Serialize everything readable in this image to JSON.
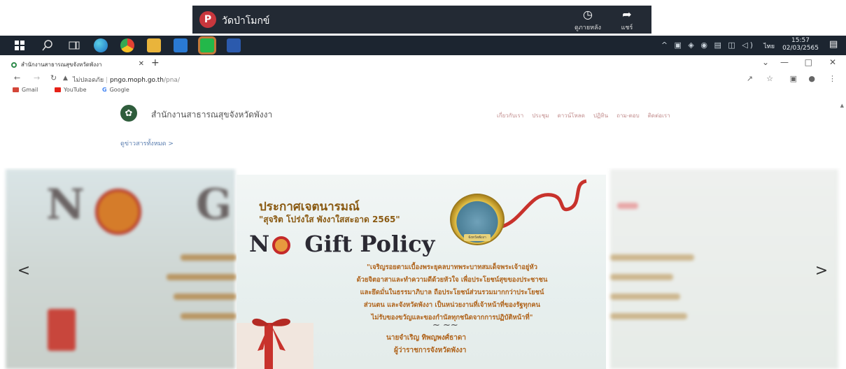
{
  "notification": {
    "avatar_letter": "P",
    "title": "วัดป่าโมกข์",
    "actions": [
      {
        "icon": "clock-icon",
        "label": "ดูภายหลัง"
      },
      {
        "icon": "share-icon",
        "label": "แชร์"
      }
    ]
  },
  "taskbar": {
    "apps": [
      "windows-start-icon",
      "search-icon",
      "task-view-icon",
      "edge-icon",
      "chrome-icon",
      "file-explorer-icon",
      "mail-icon",
      "line-icon",
      "word-icon"
    ],
    "language": "ไทย",
    "time": "15:57",
    "date": "02/03/2565"
  },
  "browser": {
    "tab_title": "สำนักงานสาธารณสุขจังหวัดพังงา",
    "security_label": "ไม่ปลอดภัย",
    "url_host": "pngo.moph.go.th",
    "url_path": "/pna/",
    "bookmarks": [
      "Gmail",
      "YouTube",
      "Google"
    ]
  },
  "site": {
    "name": "สำนักงานสาธารณสุขจังหวัดพังงา",
    "menu": [
      "เกี่ยวกับเรา",
      "ประชุม",
      "ดาวน์โหลด",
      "ปฏิทิน",
      "ถาม-ตอบ",
      "ติดต่อเรา"
    ],
    "news_link": "ดูข่าวสารทั้งหมด >"
  },
  "slide": {
    "heading": "ประกาศเจตนารมณ์",
    "subheading": "\"สุจริต โปร่งใส พังงาใสสะอาด 2565\"",
    "no_letter": "N",
    "policy": "Gift Policy",
    "quote_lines": [
      "\"เจริญรอยตามเบื้องพระยุคลบาทพระบาทสมเด็จพระเจ้าอยู่หัว",
      "ด้วยจิตอาสาและทำความดีด้วยหัวใจ เพื่อประโยชน์สุขของประชาชน",
      "และยึดมั่นในธรรมาภิบาล ถือประโยชน์ส่วนรวมมากกว่าประโยชน์",
      "ส่วนตน และจังหวัดพังงา เป็นหน่วยงานที่เจ้าหน้าที่ของรัฐทุกคน",
      "ไม่รับของขวัญและของกำนัลทุกชนิดจากการปฏิบัติหน้าที่\""
    ],
    "signer_name": "นายจำเริญ ทิพญพงศ์ธาดา",
    "signer_title": "ผู้ว่าราชการจังหวัดพังงา",
    "seal_text": "จังหวัดพังงา"
  },
  "blurred_slide": {
    "big_letters": [
      "N",
      "G"
    ]
  },
  "carousel": {
    "prev": "<",
    "next": ">"
  },
  "colors": {
    "taskbar": "#1c2530",
    "notification_bg": "#232a34",
    "accent_gold": "#8a5a12",
    "quote_orange": "#b0641c",
    "menu_pink": "#c28d8d"
  }
}
